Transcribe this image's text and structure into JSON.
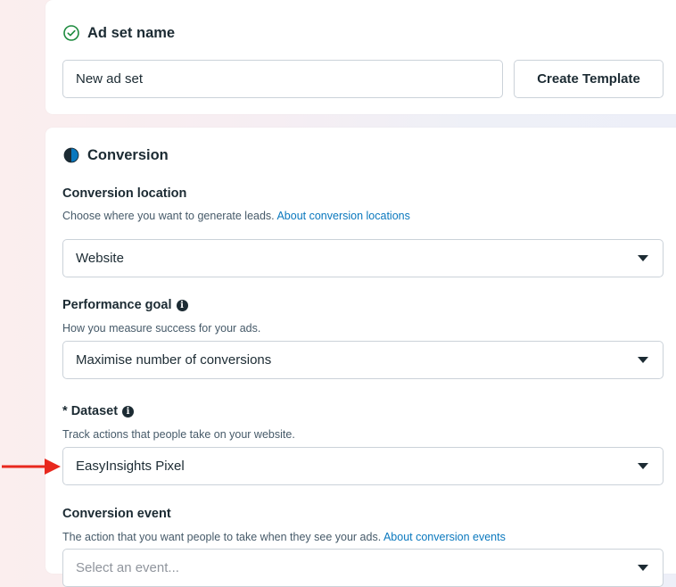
{
  "ad_set_section": {
    "title": "Ad set name",
    "name_value": "New ad set",
    "create_template_label": "Create Template"
  },
  "conversion_section": {
    "title": "Conversion",
    "location": {
      "label": "Conversion location",
      "description": "Choose where you want to generate leads.",
      "link": "About conversion locations",
      "selected": "Website"
    },
    "performance_goal": {
      "label": "Performance goal",
      "description": "How you measure success for your ads.",
      "selected": "Maximise number of conversions"
    },
    "dataset": {
      "required_mark": "*",
      "label": "Dataset",
      "description": "Track actions that people take on your website.",
      "selected": "EasyInsights Pixel"
    },
    "conversion_event": {
      "label": "Conversion event",
      "description": "The action that you want people to take when they see your ads.",
      "link": "About conversion events",
      "placeholder": "Select an event..."
    }
  },
  "colors": {
    "accent_green": "#1c8a3d",
    "link_blue": "#0a78be",
    "annotation_red": "#e8281e"
  },
  "icons": [
    "check-circle-icon",
    "half-circle-icon",
    "info-icon",
    "dropdown-caret-icon",
    "red-arrow"
  ]
}
